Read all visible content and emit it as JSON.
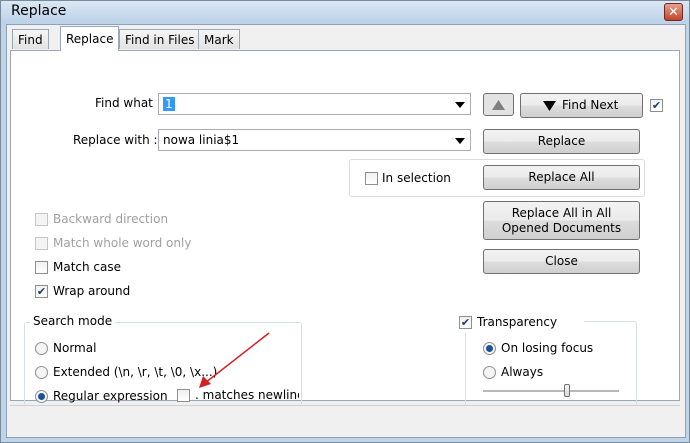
{
  "window": {
    "title": "Replace",
    "close_label": "✕"
  },
  "tabs": [
    {
      "label": "Find"
    },
    {
      "label": "Replace"
    },
    {
      "label": "Find in Files"
    },
    {
      "label": "Mark"
    }
  ],
  "find": {
    "label": "Find what :",
    "value": "1"
  },
  "replace": {
    "label": "Replace with :",
    "value": "nowa linia$1"
  },
  "buttons": {
    "find_next": "Find Next",
    "replace": "Replace",
    "replace_all": "Replace All",
    "replace_all_opened": "Replace All in All Opened Documents",
    "close": "Close"
  },
  "in_selection": {
    "label": "In selection",
    "checked": false
  },
  "options": {
    "backward": {
      "label": "Backward direction",
      "checked": false,
      "enabled": false
    },
    "whole_word": {
      "label": "Match whole word only",
      "checked": false,
      "enabled": false
    },
    "match_case": {
      "label": "Match case",
      "checked": false,
      "enabled": true
    },
    "wrap_around": {
      "label": "Wrap around",
      "checked": true,
      "enabled": true
    }
  },
  "search_mode": {
    "title": "Search mode",
    "normal": "Normal",
    "extended": "Extended (\\n, \\r, \\t, \\0, \\x...)",
    "regex": "Regular expression",
    "selected": "regex",
    "dot_newline": ". matches newline"
  },
  "transparency": {
    "label": "Transparency",
    "checked": true,
    "on_losing_focus": "On losing focus",
    "always": "Always",
    "selected": "on_losing_focus",
    "slider_level": 0.62
  },
  "colors": {
    "annotation_arrow": "#d42020",
    "selection": "#3399ff"
  }
}
